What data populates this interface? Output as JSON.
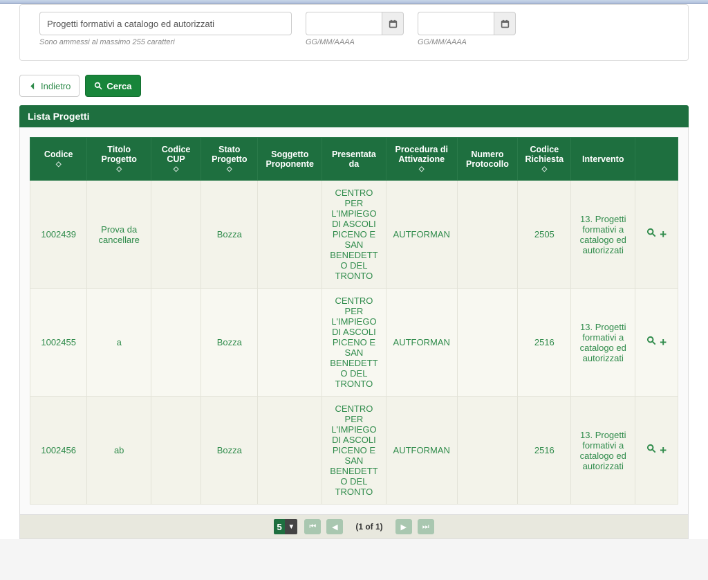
{
  "filters": {
    "text_value": "Progetti formativi a catalogo ed autorizzati",
    "text_help": "Sono ammessi al massimo 255 caratteri",
    "date_help": "GG/MM/AAAA"
  },
  "buttons": {
    "back": "Indietro",
    "search": "Cerca"
  },
  "panel": {
    "title": "Lista Progetti"
  },
  "table": {
    "headers": {
      "codice": "Codice",
      "titolo": "Titolo Progetto",
      "cup": "Codice CUP",
      "stato": "Stato Progetto",
      "soggetto": "Soggetto Proponente",
      "presentata": "Presentata da",
      "procedura": "Procedura di Attivazione",
      "numprot": "Numero Protocollo",
      "codric": "Codice Richiesta",
      "intervento": "Intervento"
    },
    "rows": [
      {
        "codice": "1002439",
        "titolo": "Prova da cancellare",
        "cup": "",
        "stato": "Bozza",
        "soggetto": "",
        "presentata": "CENTRO PER L'IMPIEGO DI ASCOLI PICENO E SAN BENEDETTO DEL TRONTO",
        "procedura": "AUTFORMAN",
        "numprot": "",
        "codric": "2505",
        "intervento": "13. Progetti formativi a catalogo ed autorizzati"
      },
      {
        "codice": "1002455",
        "titolo": "a",
        "cup": "",
        "stato": "Bozza",
        "soggetto": "",
        "presentata": "CENTRO PER L'IMPIEGO DI ASCOLI PICENO E SAN BENEDETTO DEL TRONTO",
        "procedura": "AUTFORMAN",
        "numprot": "",
        "codric": "2516",
        "intervento": "13. Progetti formativi a catalogo ed autorizzati"
      },
      {
        "codice": "1002456",
        "titolo": "ab",
        "cup": "",
        "stato": "Bozza",
        "soggetto": "",
        "presentata": "CENTRO PER L'IMPIEGO DI ASCOLI PICENO E SAN BENEDETTO DEL TRONTO",
        "procedura": "AUTFORMAN",
        "numprot": "",
        "codric": "2516",
        "intervento": "13. Progetti formativi a catalogo ed autorizzati"
      }
    ]
  },
  "pager": {
    "page_size": "5",
    "label": "(1 of 1)"
  }
}
